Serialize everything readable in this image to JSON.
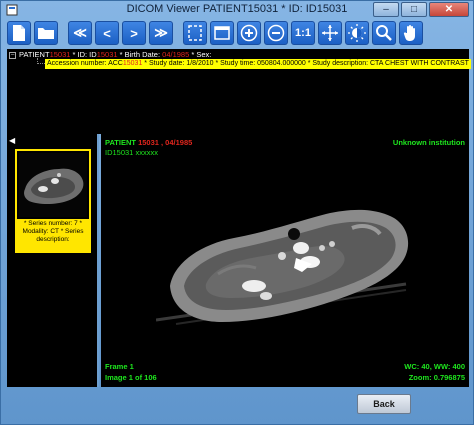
{
  "window": {
    "title": "DICOM Viewer PATIENT15031 * ID: ID15031",
    "minimize": "–",
    "maximize": "□",
    "close": "✕"
  },
  "toolbar": {
    "buttons": [
      {
        "name": "new-document-icon"
      },
      {
        "name": "open-folder-icon"
      },
      {
        "name": "first-image-button",
        "label": "≪"
      },
      {
        "name": "previous-image-button",
        "label": "<"
      },
      {
        "name": "next-image-button",
        "label": ">"
      },
      {
        "name": "last-image-button",
        "label": "≫"
      },
      {
        "name": "fit-frame-icon"
      },
      {
        "name": "window-icon"
      },
      {
        "name": "zoom-in-icon",
        "label": "+"
      },
      {
        "name": "zoom-out-icon",
        "label": "−"
      },
      {
        "name": "actual-size-button",
        "label": "1:1"
      },
      {
        "name": "pan-icon"
      },
      {
        "name": "contrast-icon"
      },
      {
        "name": "magnifier-icon"
      },
      {
        "name": "hand-icon"
      }
    ]
  },
  "info": {
    "patient_line_prefix": "PATIENT",
    "patient_redacted": "15031",
    "id_prefix": " * ID: ID",
    "id_redacted": "15031",
    "birth_prefix": " * Birth Date: ",
    "birth_redacted": "04/1985",
    "sex_suffix": " * Sex:",
    "study_line_prefix": "Accession number: ACC",
    "accession_redacted": "15031",
    "study_line_suffix": " * Study date: 1/8/2010 * Study time: 050804.000000 * Study description: CTA CHEST WITH CONTRAST"
  },
  "series": {
    "caption": "* Series number: 7 * Modality: CT * Series description:"
  },
  "viewer": {
    "patient_prefix": "PATIENT",
    "patient_redacted": "15031 , 04/1985",
    "name_redacted": "ID15031 xxxxxx",
    "institution": "Unknown institution",
    "frame": "Frame 1",
    "image_counter": "Image 1 of 106",
    "window_level": "WC: 40, WW: 400",
    "zoom": "Zoom: 0.796875"
  },
  "bottom": {
    "back_label": "Back"
  },
  "colors": {
    "overlay_text": "#1ee61e",
    "highlight": "#ffff00",
    "redaction": "#e0261d"
  }
}
